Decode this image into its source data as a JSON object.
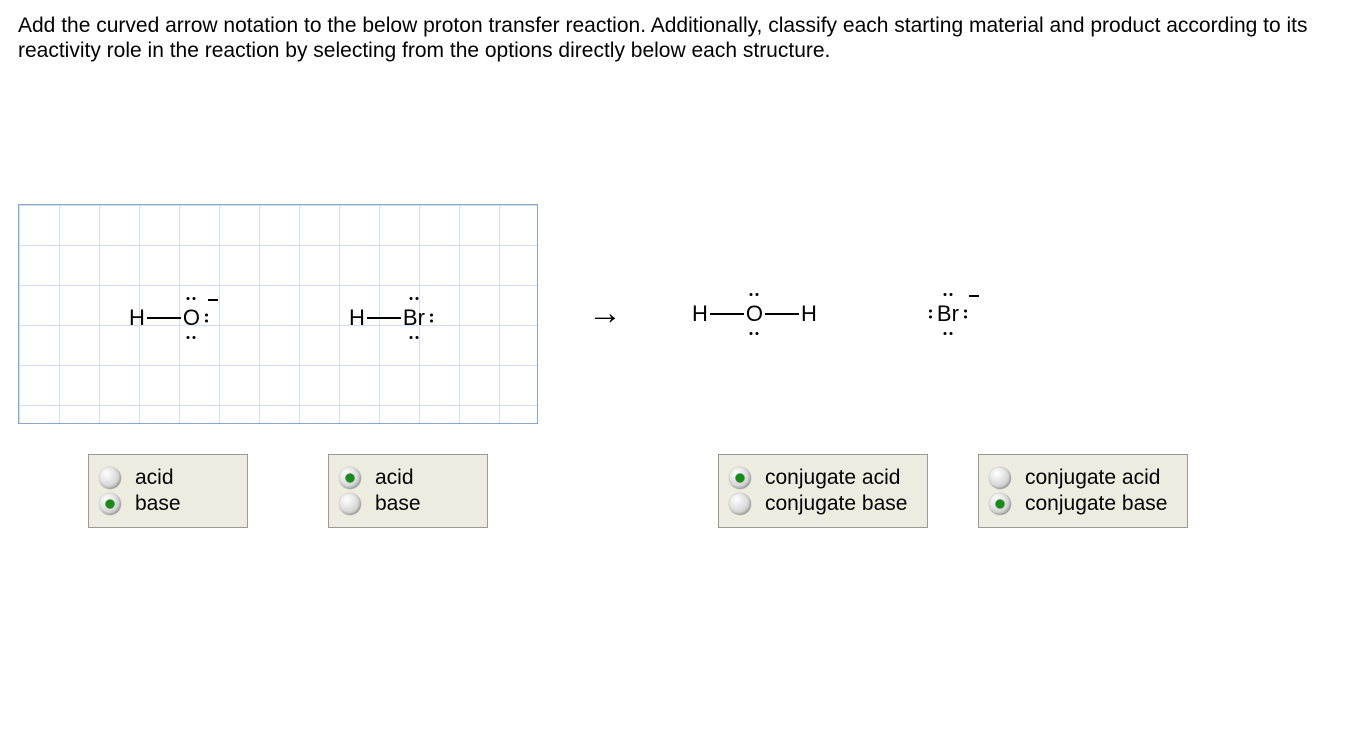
{
  "question": "Add the curved arrow notation to the below proton transfer reaction. Additionally, classify each starting material and product according to its reactivity role in the reaction by selecting from the options directly below each structure.",
  "groups": [
    {
      "opts": [
        {
          "label": "acid",
          "selected": false
        },
        {
          "label": "base",
          "selected": true
        }
      ]
    },
    {
      "opts": [
        {
          "label": "acid",
          "selected": true
        },
        {
          "label": "base",
          "selected": false
        }
      ]
    },
    {
      "opts": [
        {
          "label": "conjugate acid",
          "selected": true
        },
        {
          "label": "conjugate base",
          "selected": false
        }
      ]
    },
    {
      "opts": [
        {
          "label": "conjugate acid",
          "selected": false
        },
        {
          "label": "conjugate base",
          "selected": true
        }
      ]
    }
  ],
  "atoms": {
    "H": "H",
    "O": "O",
    "Br": "Br"
  }
}
